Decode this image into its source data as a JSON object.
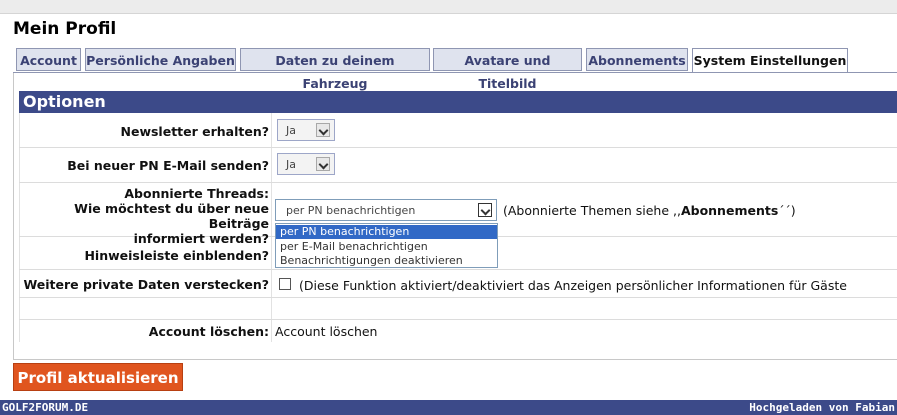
{
  "page": {
    "title": "Mein Profil"
  },
  "tabs": [
    {
      "label": "Account"
    },
    {
      "label": "Persönliche Angaben"
    },
    {
      "label": "Daten zu deinem Fahrzeug"
    },
    {
      "label": "Avatare und Titelbild"
    },
    {
      "label": "Abonnements"
    },
    {
      "label": "System Einstellungen"
    }
  ],
  "options": {
    "heading": "Optionen",
    "newsletter": {
      "label": "Newsletter erhalten?",
      "value": "Ja"
    },
    "pn_email": {
      "label": "Bei neuer PN E-Mail senden?",
      "value": "Ja"
    },
    "threads": {
      "label_line1": "Abonnierte Threads:",
      "label_line2": "Wie möchtest du über neue Beiträge",
      "label_line3": "informiert werden?",
      "value": "per PN benachrichtigen",
      "note_prefix": "(Abonnierte Themen siehe ,,",
      "note_bold": "Abonnements",
      "note_suffix": "´´)",
      "dropdown_options": [
        "per PN benachrichtigen",
        "per E-Mail benachrichtigen",
        "Benachrichtigungen deaktivieren"
      ]
    },
    "hint_bar": {
      "label": "Hinweisleiste einblenden?"
    },
    "hide_data": {
      "label": "Weitere private Daten verstecken?",
      "note": "(Diese Funktion aktiviert/deaktiviert das Anzeigen persönlicher Informationen für Gäste",
      "checked": false
    },
    "delete_account": {
      "label": "Account löschen:",
      "value": "Account löschen"
    }
  },
  "actions": {
    "update_label": "Profil aktualisieren"
  },
  "footer": {
    "left": "GOLF2FORUM.DE",
    "right": "Hochgeladen von Fabian"
  }
}
